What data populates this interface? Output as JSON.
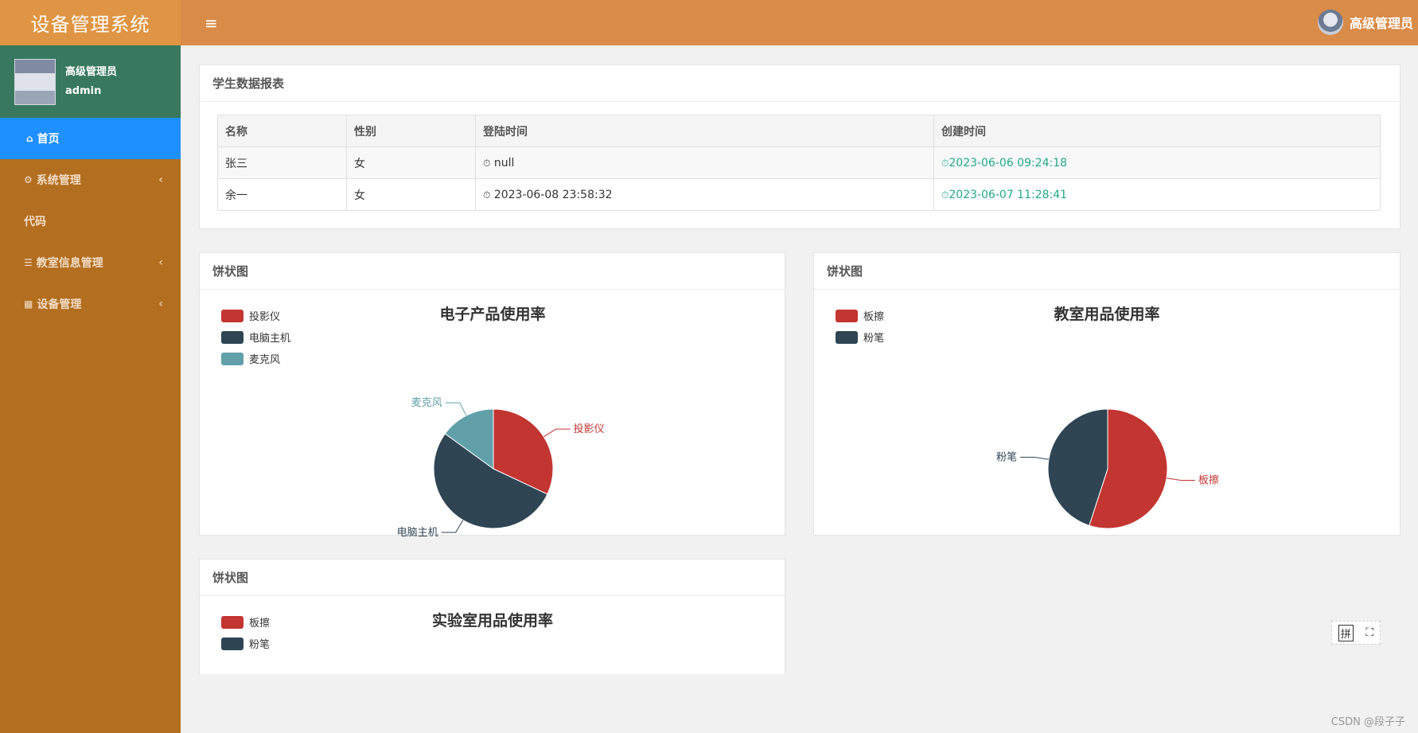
{
  "app": {
    "title": "设备管理系统",
    "menu_icon": "≡"
  },
  "topbar": {
    "user_name": "高级管理员"
  },
  "sidebar": {
    "user": {
      "role": "高级管理员",
      "username": "admin"
    },
    "items": [
      {
        "label": "首页",
        "icon": "home-icon",
        "glyph": "⌂"
      },
      {
        "label": "系统管理",
        "icon": "gear-icon",
        "glyph": "⚙"
      },
      {
        "label": "代码",
        "icon": "",
        "glyph": ""
      },
      {
        "label": "教室信息管理",
        "icon": "sliders-icon",
        "glyph": "☰"
      },
      {
        "label": "设备管理",
        "icon": "table-icon",
        "glyph": "▦"
      }
    ]
  },
  "report": {
    "title": "学生数据报表",
    "columns": [
      "名称",
      "性别",
      "登陆时间",
      "创建时间"
    ],
    "rows": [
      {
        "name": "张三",
        "gender": "女",
        "login": "null",
        "created": "2023-06-06 09:24:18"
      },
      {
        "name": "余一",
        "gender": "女",
        "login": "2023-06-08 23:58:32",
        "created": "2023-06-07 11:28:41"
      }
    ]
  },
  "panels": [
    {
      "heading": "饼状图"
    },
    {
      "heading": "饼状图"
    },
    {
      "heading": "饼状图"
    }
  ],
  "chart_data": [
    {
      "type": "pie",
      "title": "电子产品使用率",
      "legend_position": "top-left",
      "slices": [
        {
          "name": "投影仪",
          "value": 32,
          "color": "#c23531"
        },
        {
          "name": "电脑主机",
          "value": 53,
          "color": "#2f4554"
        },
        {
          "name": "麦克风",
          "value": 15,
          "color": "#61a0a8"
        }
      ]
    },
    {
      "type": "pie",
      "title": "教室用品使用率",
      "legend_position": "top-left",
      "slices": [
        {
          "name": "板擦",
          "value": 55,
          "color": "#c23531"
        },
        {
          "name": "粉笔",
          "value": 45,
          "color": "#2f4554"
        }
      ]
    },
    {
      "type": "pie",
      "title": "实验室用品使用率",
      "legend_position": "top-left",
      "slices": [
        {
          "name": "板擦",
          "value": 0,
          "color": "#c23531"
        },
        {
          "name": "粉笔",
          "value": 0,
          "color": "#2f4554"
        }
      ]
    }
  ],
  "ime": {
    "label": "拼"
  },
  "watermark": "CSDN @段子子"
}
